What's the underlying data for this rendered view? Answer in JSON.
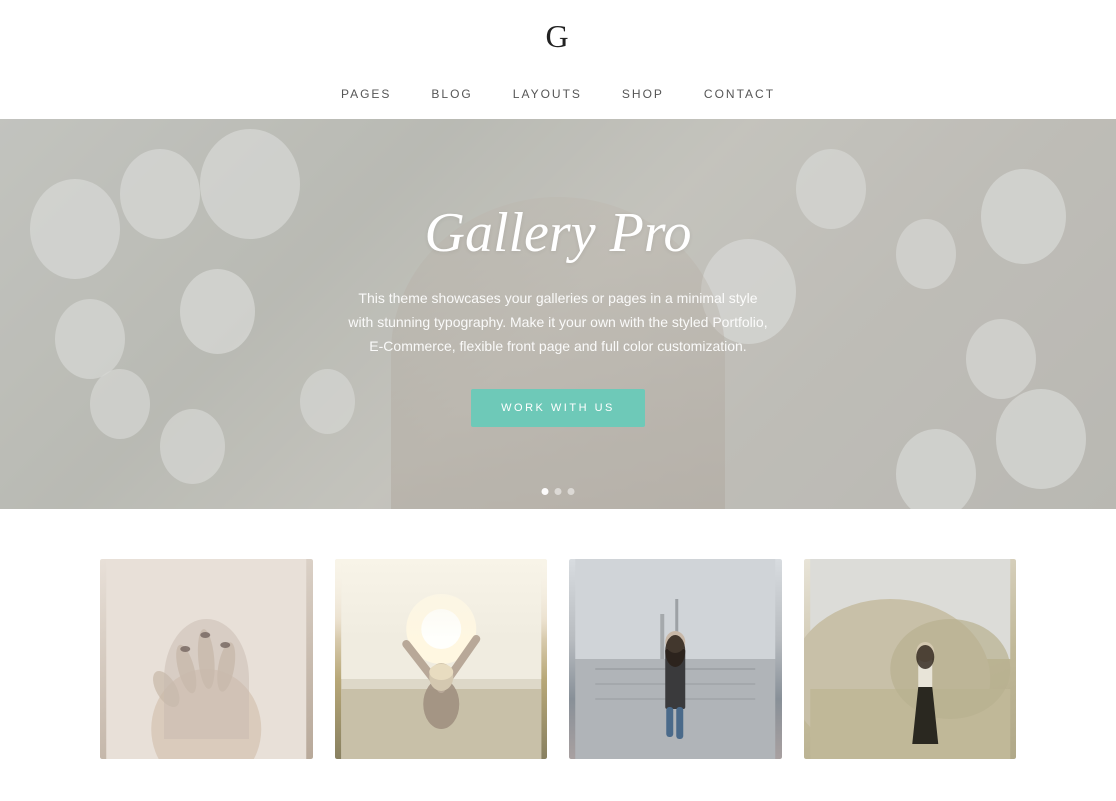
{
  "header": {
    "logo": "G",
    "nav": {
      "items": [
        {
          "label": "PAGES",
          "id": "pages"
        },
        {
          "label": "BLOG",
          "id": "blog"
        },
        {
          "label": "LAYOUTS",
          "id": "layouts"
        },
        {
          "label": "SHOP",
          "id": "shop"
        },
        {
          "label": "CONTACT",
          "id": "contact"
        }
      ]
    }
  },
  "hero": {
    "title": "Gallery Pro",
    "subtitle": "This theme showcases your galleries or pages in a minimal style with stunning typography. Make it your own with the styled Portfolio, E-Commerce, flexible front page and full color customization.",
    "button_label": "WORK WITH US",
    "dots": [
      {
        "active": true
      },
      {
        "active": false
      },
      {
        "active": false
      }
    ]
  },
  "gallery": {
    "images": [
      {
        "alt": "hands pose photo",
        "id": "photo-1"
      },
      {
        "alt": "woman arms raised photo",
        "id": "photo-2"
      },
      {
        "alt": "woman walking photo",
        "id": "photo-3"
      },
      {
        "alt": "landscape with person photo",
        "id": "photo-4"
      }
    ]
  }
}
